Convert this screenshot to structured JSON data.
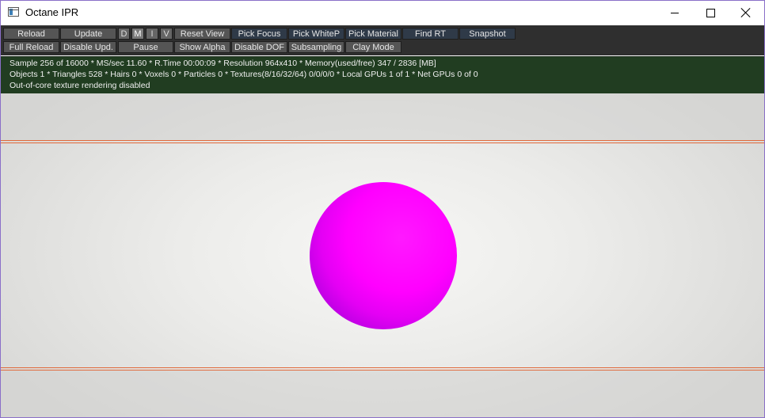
{
  "window": {
    "title": "Octane IPR"
  },
  "toolbar": {
    "row1": [
      {
        "label": "Reload",
        "style": "gray"
      },
      {
        "label": "Update",
        "style": "gray"
      },
      {
        "label": "D",
        "style": "toggle-off"
      },
      {
        "label": "M",
        "style": "toggle-on"
      },
      {
        "label": "I",
        "style": "toggle-off"
      },
      {
        "label": "V",
        "style": "toggle-off"
      },
      {
        "label": "Reset View",
        "style": "gray"
      },
      {
        "label": "Pick Focus",
        "style": "blue"
      },
      {
        "label": "Pick WhiteP",
        "style": "blue"
      },
      {
        "label": "Pick Material",
        "style": "blue"
      },
      {
        "label": "Find RT",
        "style": "blue"
      },
      {
        "label": "Snapshot",
        "style": "blue"
      }
    ],
    "row2": [
      {
        "label": "Full Reload",
        "style": "gray"
      },
      {
        "label": "Disable Upd.",
        "style": "gray"
      },
      {
        "label": "Pause",
        "style": "gray"
      },
      {
        "label": "Show Alpha",
        "style": "gray"
      },
      {
        "label": "Disable DOF",
        "style": "gray"
      },
      {
        "label": "Subsampling",
        "style": "gray"
      },
      {
        "label": "Clay Mode",
        "style": "gray"
      }
    ]
  },
  "status": {
    "line1": "Sample 256 of 16000 * MS/sec 11.60 * R.Time 00:00:09 * Resolution 964x410 * Memory(used/free) 347 / 2836 [MB]",
    "line2": "Objects 1 * Triangles 528 * Hairs 0 * Voxels 0 * Particles 0 * Textures(8/16/32/64) 0/0/0/0 * Local GPUs 1 of 1 * Net GPUs 0 of 0",
    "line3": "Out-of-core texture rendering disabled"
  },
  "viewport": {
    "background_color": "#e9e9e7",
    "guide_color": "#e0693b",
    "object_color": "#ff00ff"
  }
}
